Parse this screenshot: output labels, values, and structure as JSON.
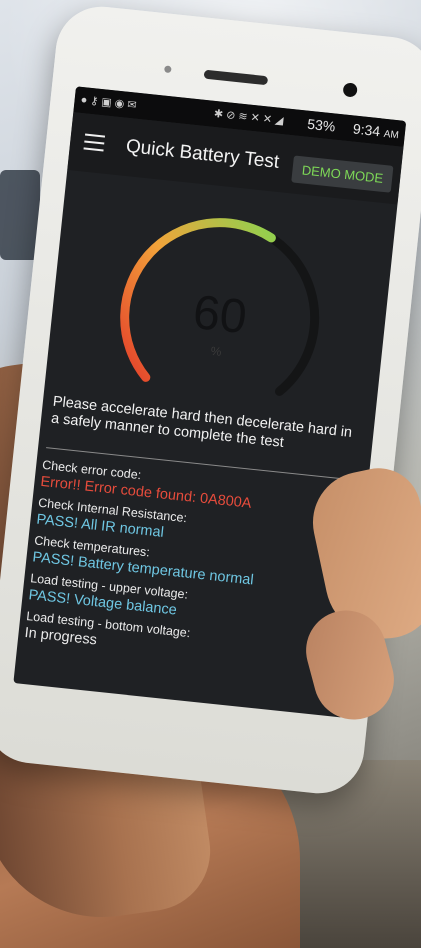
{
  "status_bar": {
    "battery": "53%",
    "time": "9:34",
    "ampm": "AM"
  },
  "app_bar": {
    "title": "Quick Battery Test",
    "demo_button": "DEMO MODE"
  },
  "gauge": {
    "value": "60",
    "unit": "%",
    "level_fraction": 0.6,
    "gradient_colors": [
      "#e23b2a",
      "#f2a33a",
      "#8fd14f"
    ]
  },
  "instruction": "Please accelerate hard then decelerate hard in a safely manner to complete the test",
  "results": [
    {
      "label": "Check error code:",
      "value": "Error!! Error code found: 0A800A",
      "status": "err"
    },
    {
      "label": "Check Internal Resistance:",
      "value": "PASS! All IR normal",
      "status": "pass"
    },
    {
      "label": "Check temperatures:",
      "value": "PASS! Battery temperature normal",
      "status": "pass"
    },
    {
      "label": "Load testing - upper voltage:",
      "value": "PASS! Voltage balance",
      "status": "pass"
    },
    {
      "label": "Load testing - bottom voltage:",
      "value": "In progress",
      "status": "prog"
    }
  ],
  "colors": {
    "error": "#e74c3c",
    "pass": "#6fc7e3",
    "demo_accent": "#7ed957"
  }
}
